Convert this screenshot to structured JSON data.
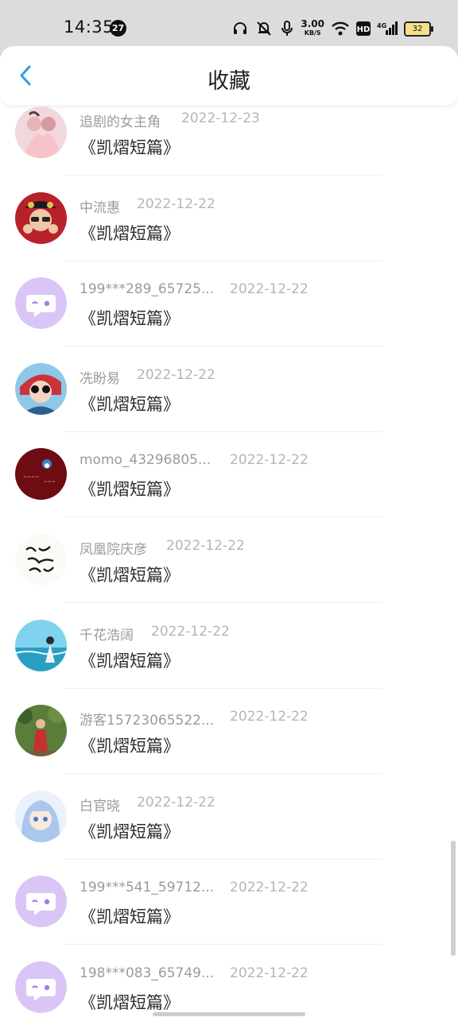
{
  "status_bar": {
    "time": "14:35",
    "notification_count": "27",
    "net_speed": "3.00",
    "net_speed_unit": "KB/S",
    "hd_label": "HD",
    "network_label": "4G",
    "battery": "32"
  },
  "header": {
    "title": "收藏"
  },
  "items": [
    {
      "name": "追剧的女主角",
      "date": "2022-12-23",
      "work": "《凯熠短篇》",
      "avatar": "photo-pink"
    },
    {
      "name": "中流惠",
      "date": "2022-12-22",
      "work": "《凯熠短篇》",
      "avatar": "photo-red"
    },
    {
      "name": "199***289_65725...",
      "date": "2022-12-22",
      "work": "《凯熠短篇》",
      "avatar": "default-chat-icon"
    },
    {
      "name": "冼盼易",
      "date": "2022-12-22",
      "work": "《凯熠短篇》",
      "avatar": "photo-sunglasses"
    },
    {
      "name": "momo_43296805...",
      "date": "2022-12-22",
      "work": "《凯熠短篇》",
      "avatar": "photo-darkred"
    },
    {
      "name": "凤凰院庆彦",
      "date": "2022-12-22",
      "work": "《凯熠短篇》",
      "avatar": "calligraphy"
    },
    {
      "name": "千花浩阔",
      "date": "2022-12-22",
      "work": "《凯熠短篇》",
      "avatar": "photo-sea"
    },
    {
      "name": "游客15723065522...",
      "date": "2022-12-22",
      "work": "《凯熠短篇》",
      "avatar": "photo-forest"
    },
    {
      "name": "白官晓",
      "date": "2022-12-22",
      "work": "《凯熠短篇》",
      "avatar": "anime-girl"
    },
    {
      "name": "199***541_59712...",
      "date": "2022-12-22",
      "work": "《凯熠短篇》",
      "avatar": "default-chat-icon"
    },
    {
      "name": "198***083_65749...",
      "date": "2022-12-22",
      "work": "《凯熠短篇》",
      "avatar": "default-chat-icon"
    }
  ],
  "colors": {
    "accent": "#2f9ee8",
    "default_avatar_bg": "#d9c6f6",
    "default_avatar_fg": "#a67be8"
  }
}
